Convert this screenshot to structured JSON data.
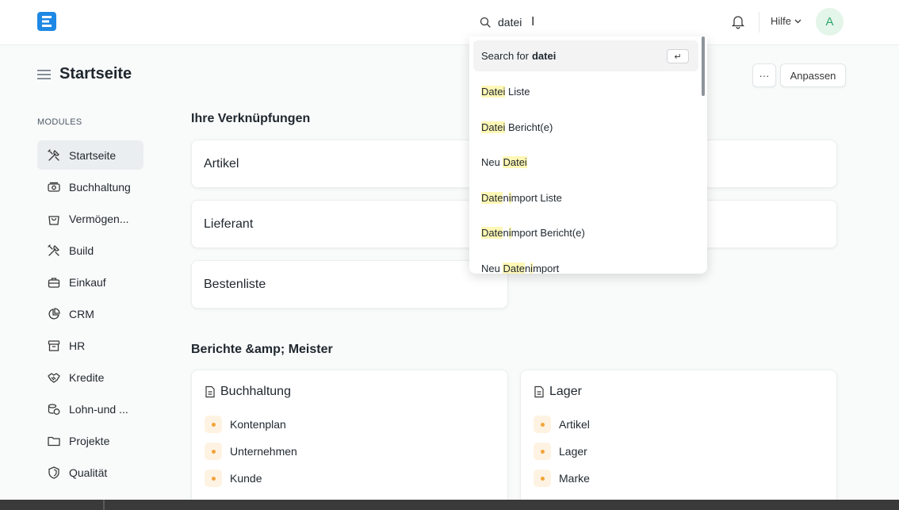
{
  "navbar": {
    "help_label": "Hilfe",
    "avatar_initial": "A"
  },
  "search": {
    "value": "datei"
  },
  "dropdown": {
    "search_prefix": "Search for",
    "search_term": "datei",
    "enter_key": "↵",
    "items": [
      {
        "highlight": "Datei",
        "rest": " Liste",
        "prefix": ""
      },
      {
        "highlight": "Datei",
        "rest": " Bericht(e)",
        "prefix": ""
      },
      {
        "prefix": "Neu ",
        "highlight": "Datei",
        "rest": ""
      },
      {
        "highlight": "Date",
        "mid": "n",
        "highlight2": "i",
        "rest": "mport Liste",
        "prefix": ""
      },
      {
        "highlight": "Date",
        "mid": "n",
        "highlight2": "i",
        "rest": "mport Bericht(e)",
        "prefix": ""
      },
      {
        "prefix": "Neu ",
        "highlight": "Date",
        "mid": "n",
        "highlight2": "i",
        "rest": "mport"
      }
    ]
  },
  "page": {
    "title": "Startseite",
    "more_label": "···",
    "customize_label": "Anpassen"
  },
  "sidebar": {
    "heading": "MODULES",
    "items": [
      {
        "label": "Startseite",
        "icon": "tools-icon",
        "active": true
      },
      {
        "label": "Buchhaltung",
        "icon": "money-icon"
      },
      {
        "label": "Vermögen...",
        "icon": "bag-icon"
      },
      {
        "label": "Build",
        "icon": "tools-icon"
      },
      {
        "label": "Einkauf",
        "icon": "briefcase-icon"
      },
      {
        "label": "CRM",
        "icon": "pie-chart-icon"
      },
      {
        "label": "HR",
        "icon": "archive-icon"
      },
      {
        "label": "Kredite",
        "icon": "handshake-icon"
      },
      {
        "label": "Lohn-und ...",
        "icon": "coins-icon"
      },
      {
        "label": "Projekte",
        "icon": "folder-icon"
      },
      {
        "label": "Qualität",
        "icon": "shield-icon"
      }
    ]
  },
  "shortcuts": {
    "title": "Ihre Verknüpfungen",
    "items": [
      "Artikel",
      "Lieferant",
      "Bestenliste"
    ]
  },
  "reports": {
    "title": "Berichte &amp; Meister",
    "cards": [
      {
        "title": "Buchhaltung",
        "items": [
          "Kontenplan",
          "Unternehmen",
          "Kunde"
        ]
      },
      {
        "title": "Lager",
        "items": [
          "Artikel",
          "Lager",
          "Marke"
        ]
      }
    ]
  }
}
